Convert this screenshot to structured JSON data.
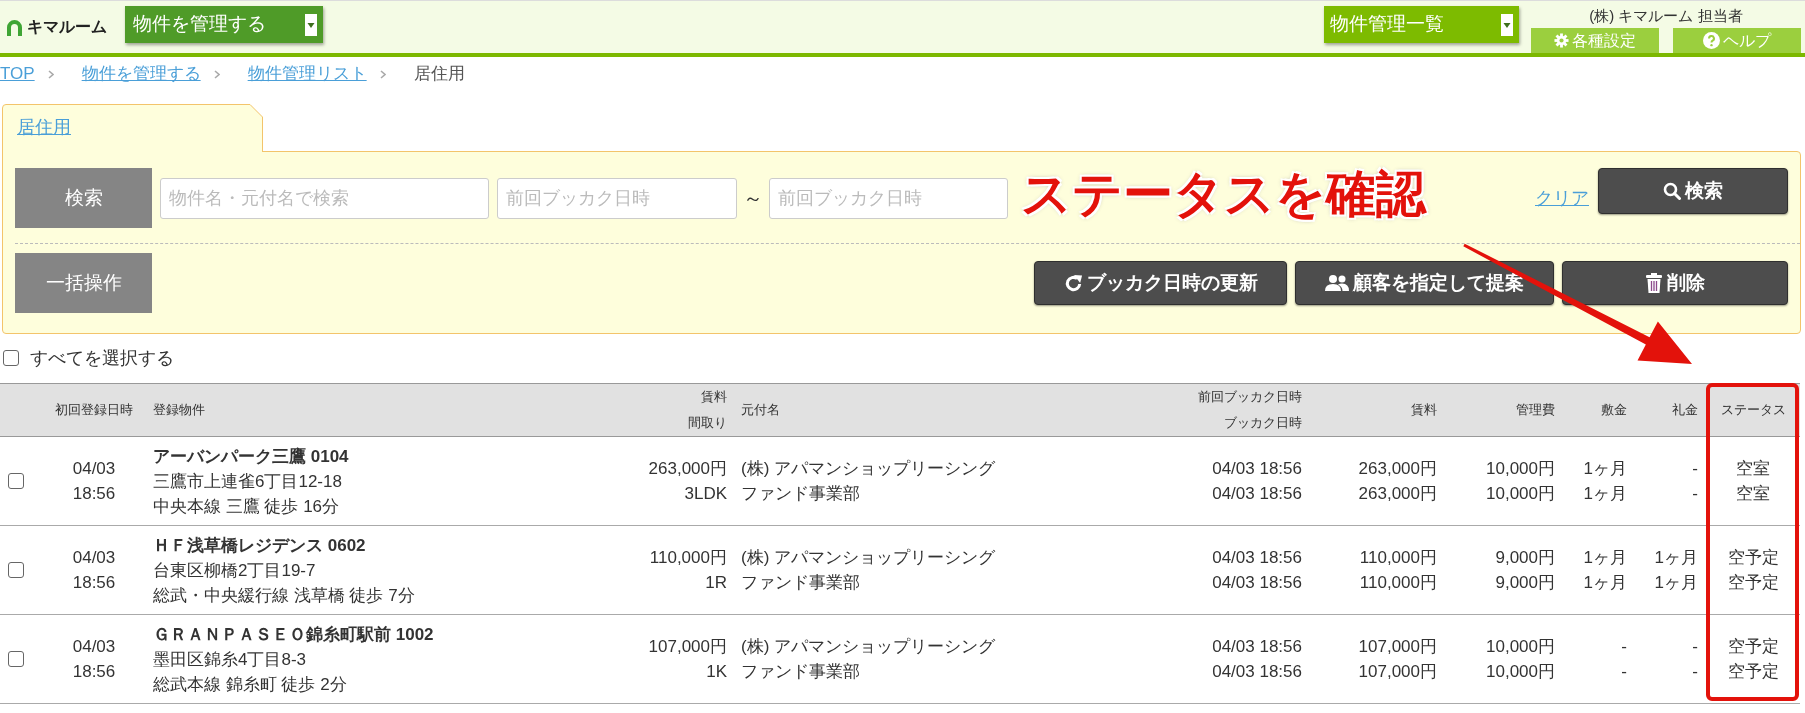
{
  "header": {
    "logo": "キマルーム",
    "menu_select": {
      "value": "物件を管理する"
    },
    "view_select": {
      "value": "物件管理一覧"
    },
    "user": "(株) キマルーム 担当者",
    "buttons": [
      {
        "kind": "settings",
        "label": "各種設定"
      },
      {
        "kind": "help",
        "label": "ヘルプ"
      }
    ]
  },
  "breadcrumb": [
    {
      "label": "TOP",
      "link": true
    },
    {
      "label": "物件を管理する",
      "link": true
    },
    {
      "label": "物件管理リスト",
      "link": true
    },
    {
      "label": "居住用",
      "link": false
    }
  ],
  "tabs": [
    {
      "label": "居住用",
      "selected": true
    }
  ],
  "search": {
    "label": "検索",
    "fields": [
      {
        "placeholder": "物件名・元付名で検索"
      },
      {
        "placeholder": "前回ブッカク日時"
      },
      {
        "placeholder": "前回ブッカク日時"
      }
    ],
    "range_separator": "～",
    "clear_link": "クリア",
    "button": "検索"
  },
  "annotation": {
    "text": "ステータスを確認"
  },
  "bulk_actions": {
    "label": "一括操作",
    "buttons": [
      {
        "kind": "refresh",
        "label": "ブッカク日時の更新"
      },
      {
        "kind": "customers",
        "label": "顧客を指定して提案"
      },
      {
        "kind": "delete",
        "label": "削除"
      }
    ]
  },
  "select_all": {
    "label": "すべてを選択する",
    "checked": false
  },
  "table": {
    "columns": [
      {
        "label": "初回登録日時",
        "highlighted": false
      },
      {
        "label": "登録物件",
        "highlighted": false
      },
      {
        "label": "賃料",
        "label_2": "間取り",
        "highlighted": false
      },
      {
        "label": "元付名",
        "highlighted": false
      },
      {
        "label": "前回ブッカク日時",
        "label_2": "ブッカク日時",
        "highlighted": false
      },
      {
        "label": "賃料",
        "highlighted": false
      },
      {
        "label": "管理費",
        "highlighted": false
      },
      {
        "label": "敷金",
        "highlighted": false
      },
      {
        "label": "礼金",
        "highlighted": false
      },
      {
        "label": "ステータス",
        "highlighted": true
      }
    ],
    "rows": [
      {
        "checked": false,
        "registered_date": "04/03",
        "registered_time": "18:56",
        "name": "アーバンパーク三鷹 0104",
        "address": "三鷹市上連雀6丁目12-18",
        "access": "中央本線 三鷹 徒歩 16分",
        "rent": "263,000円",
        "layout": "3LDK",
        "agent": "(株) アパマンショップリーシング",
        "department": "ファンド事業部",
        "bookings": [
          {
            "datetime": "04/03 18:56",
            "rent": "263,000円",
            "management_fee": "10,000円",
            "deposit": "1ヶ月",
            "key_money": "-",
            "status": "空室"
          },
          {
            "datetime": "04/03 18:56",
            "rent": "263,000円",
            "management_fee": "10,000円",
            "deposit": "1ヶ月",
            "key_money": "-",
            "status": "空室"
          }
        ]
      },
      {
        "checked": false,
        "registered_date": "04/03",
        "registered_time": "18:56",
        "name": "ＨＦ浅草橋レジデンス 0602",
        "address": "台東区柳橋2丁目19-7",
        "access": "総武・中央緩行線 浅草橋 徒歩 7分",
        "rent": "110,000円",
        "layout": "1R",
        "agent": "(株) アパマンショップリーシング",
        "department": "ファンド事業部",
        "bookings": [
          {
            "datetime": "04/03 18:56",
            "rent": "110,000円",
            "management_fee": "9,000円",
            "deposit": "1ヶ月",
            "key_money": "1ヶ月",
            "status": "空予定"
          },
          {
            "datetime": "04/03 18:56",
            "rent": "110,000円",
            "management_fee": "9,000円",
            "deposit": "1ヶ月",
            "key_money": "1ヶ月",
            "status": "空予定"
          }
        ]
      },
      {
        "checked": false,
        "registered_date": "04/03",
        "registered_time": "18:56",
        "name": "ＧＲＡＮＰＡＳＥＯ錦糸町駅前 1002",
        "address": "墨田区錦糸4丁目8-3",
        "access": "総武本線 錦糸町 徒歩 2分",
        "rent": "107,000円",
        "layout": "1K",
        "agent": "(株) アパマンショップリーシング",
        "department": "ファンド事業部",
        "bookings": [
          {
            "datetime": "04/03 18:56",
            "rent": "107,000円",
            "management_fee": "10,000円",
            "deposit": "-",
            "key_money": "-",
            "status": "空予定"
          },
          {
            "datetime": "04/03 18:56",
            "rent": "107,000円",
            "management_fee": "10,000円",
            "deposit": "-",
            "key_money": "-",
            "status": "空予定"
          }
        ]
      }
    ]
  }
}
